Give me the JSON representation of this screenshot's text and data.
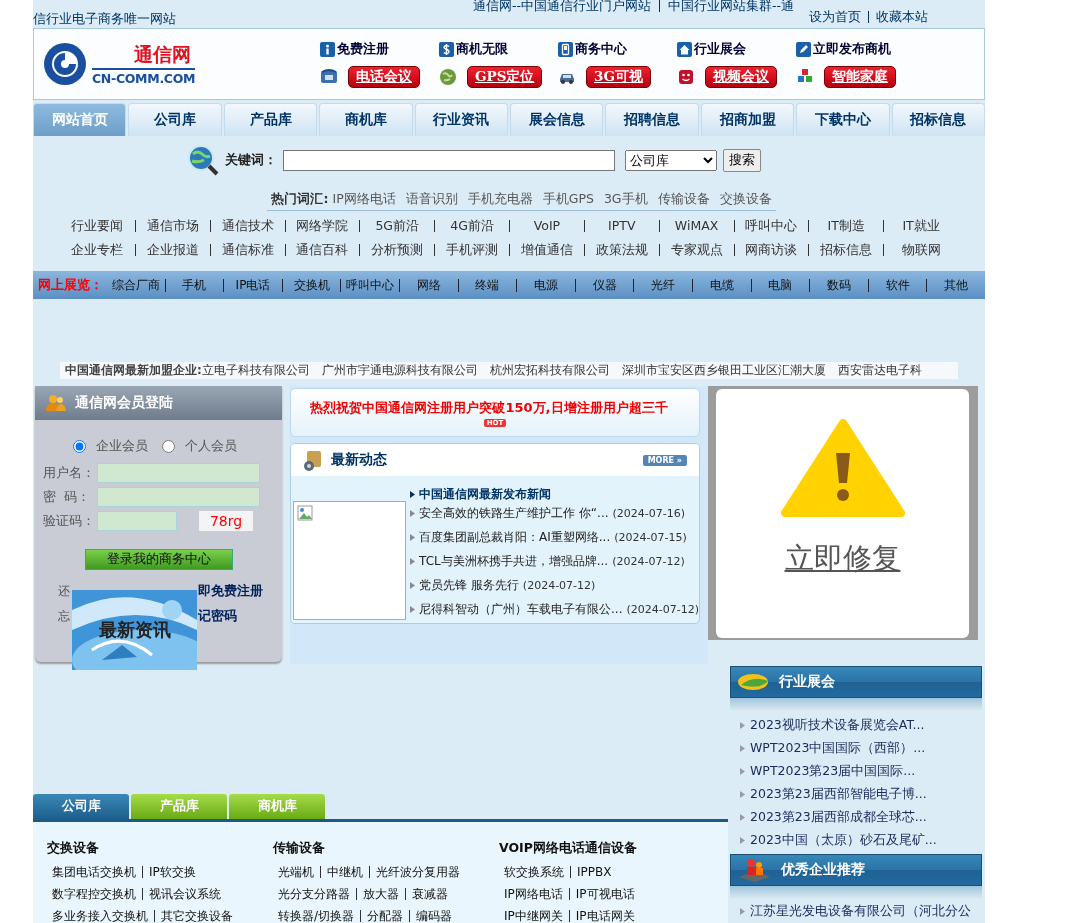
{
  "top_bar": {
    "tagline": "信行业电子商务唯一网站",
    "portal_links": [
      "通信网--中国通信行业门户网站",
      "中国行业网站集群--通"
    ],
    "site_links": [
      "设为首页",
      "收藏本站"
    ]
  },
  "logo": {
    "name": "通信网",
    "domain": "CN-COMM.COM"
  },
  "quick_links": [
    "免费注册",
    "商机无限",
    "商务中心",
    "行业展会",
    "立即发布商机"
  ],
  "services": [
    "电话会议",
    "GPS定位",
    "3G可视",
    "视频会议",
    "智能家庭"
  ],
  "nav_tabs": [
    {
      "label": "网站首页",
      "selected": true
    },
    {
      "label": "公司库",
      "selected": false
    },
    {
      "label": "产品库",
      "selected": false
    },
    {
      "label": "商机库",
      "selected": false
    },
    {
      "label": "行业资讯",
      "selected": false
    },
    {
      "label": "展会信息",
      "selected": false
    },
    {
      "label": "招聘信息",
      "selected": false
    },
    {
      "label": "招商加盟",
      "selected": false
    },
    {
      "label": "下载中心",
      "selected": false
    },
    {
      "label": "招标信息",
      "selected": false
    }
  ],
  "search": {
    "label": "关键词：",
    "category": "公司库",
    "button": "搜索",
    "hot_label": "热门词汇:",
    "hot_words": [
      "IP网络电话",
      "语音识别",
      "手机充电器",
      "手机GPS",
      "3G手机",
      "传输设备",
      "交换设备"
    ]
  },
  "channels": [
    [
      "行业要闻",
      "通信市场",
      "通信技术",
      "网络学院",
      "5G前沿",
      "4G前沿",
      "VoIP",
      "IPTV",
      "WiMAX",
      "呼叫中心",
      "IT制造",
      "IT就业"
    ],
    [
      "企业专栏",
      "企业报道",
      "通信标准",
      "通信百科",
      "分析预测",
      "手机评测",
      "增值通信",
      "政策法规",
      "专家观点",
      "网商访谈",
      "招标信息",
      "物联网"
    ]
  ],
  "exhibition": {
    "label": "网上展览：",
    "items": [
      "综合厂商",
      "手机",
      "IP电话",
      "交换机",
      "呼叫中心",
      "网络",
      "终端",
      "电源",
      "仪器",
      "光纤",
      "电缆",
      "电脑",
      "数码",
      "软件",
      "其他"
    ]
  },
  "new_members": {
    "label": "中国通信网最新加盟企业:",
    "companies": [
      "立电子科技有限公司",
      "广州市宇通电源科技有限公司",
      "杭州宏拓科技有限公司",
      "深圳市宝安区西乡银田工业区汇潮大厦",
      "西安雷达电子科"
    ]
  },
  "login": {
    "title": "通信网会员登陆",
    "member_types": [
      {
        "label": "企业会员",
        "selected": true
      },
      {
        "label": "个人会员",
        "selected": false
      }
    ],
    "username_label": "用户名：",
    "password_label": "密  码：",
    "captcha_label": "验证码：",
    "captcha": "78rg",
    "submit": "登录我的商务中心",
    "register_prompt": "还",
    "register_link": "即免费注册",
    "forgot_prompt": "忘",
    "forgot_link": "记密码"
  },
  "banner": {
    "title": "最新资讯"
  },
  "announcement": {
    "text": "热烈祝贺中国通信网注册用户突破150万,日增注册用户超三千",
    "badge": "HOT"
  },
  "news": {
    "title": "最新动态",
    "more": "MORE »",
    "headline": "中国通信网最新发布新闻",
    "items": [
      {
        "title": "安全高效的铁路生产维护工作 你“...",
        "date": "(2024-07-16)"
      },
      {
        "title": "百度集团副总裁肖阳：AI重塑网络...",
        "date": "(2024-07-15)"
      },
      {
        "title": "TCL与美洲杯携手共进，增强品牌...",
        "date": "(2024-07-12)"
      },
      {
        "title": "党员先锋 服务先行",
        "date": "(2024-07-12)"
      },
      {
        "title": "尼得科智动（广州）车载电子有限公...",
        "date": "(2024-07-12)"
      }
    ]
  },
  "warning": {
    "action": "立即修复"
  },
  "exhibitions": {
    "title": "行业展会",
    "items": [
      "2023视听技术设备展览会AT...",
      "WPT2023中国国际（西部）...",
      "WPT2023第23届中国国际...",
      "2023第23届西部智能电子博...",
      "2023第23届西部成都全球芯...",
      "2023中国（太原）砂石及尾矿..."
    ]
  },
  "featured": {
    "title": "优秀企业推荐",
    "items": [
      "江苏星光发电设备有限公司（河北分公"
    ]
  },
  "catalog": {
    "tabs": [
      {
        "label": "公司库",
        "selected": true
      },
      {
        "label": "产品库",
        "selected": false
      },
      {
        "label": "商机库",
        "selected": false
      }
    ],
    "groups": [
      {
        "title": "交换设备",
        "lines": [
          [
            "集团电话交换机",
            "IP软交换"
          ],
          [
            "数字程控交换机",
            "视讯会议系统"
          ],
          [
            "多业务接入交换机",
            "其它交换设备"
          ]
        ]
      },
      {
        "title": "传输设备",
        "lines": [
          [
            "光端机",
            "中继机",
            "光纤波分复用器"
          ],
          [
            "光分支分路器",
            "放大器",
            "衰减器"
          ],
          [
            "转换器/切换器",
            "分配器",
            "编码器"
          ]
        ]
      },
      {
        "title": "VOIP网络电话通信设备",
        "lines": [
          [
            "软交换系统",
            "IPPBX"
          ],
          [
            "IP网络电话",
            "IP可视电话"
          ],
          [
            "IP中继网关",
            "IP电话网关"
          ]
        ]
      }
    ]
  }
}
